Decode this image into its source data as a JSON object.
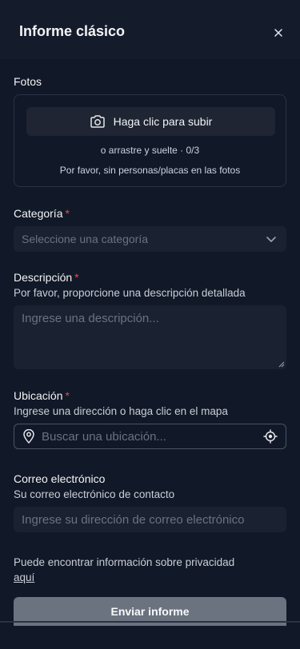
{
  "header": {
    "title": "Informe clásico"
  },
  "photos": {
    "label": "Fotos",
    "upload_label": "Haga clic para subir",
    "drag_text": "o arrastre y suelte · 0/3",
    "note": "Por favor, sin personas/placas en las fotos"
  },
  "category": {
    "label": "Categoría",
    "required": "*",
    "placeholder": "Seleccione una categoría"
  },
  "description": {
    "label": "Descripción",
    "required": "*",
    "hint": "Por favor, proporcione una descripción detallada",
    "placeholder": "Ingrese una descripción..."
  },
  "location": {
    "label": "Ubicación",
    "required": "*",
    "hint": "Ingrese una dirección o haga clic en el mapa",
    "placeholder": "Buscar una ubicación..."
  },
  "email": {
    "label": "Correo electrónico",
    "hint": "Su correo electrónico de contacto",
    "placeholder": "Ingrese su dirección de correo electrónico"
  },
  "privacy": {
    "text": "Puede encontrar información sobre privacidad",
    "link": "aquí"
  },
  "submit": {
    "label": "Enviar informe"
  },
  "colors": {
    "background": "#111827",
    "required": "#ef4444",
    "submit_bg": "#6b7280"
  }
}
